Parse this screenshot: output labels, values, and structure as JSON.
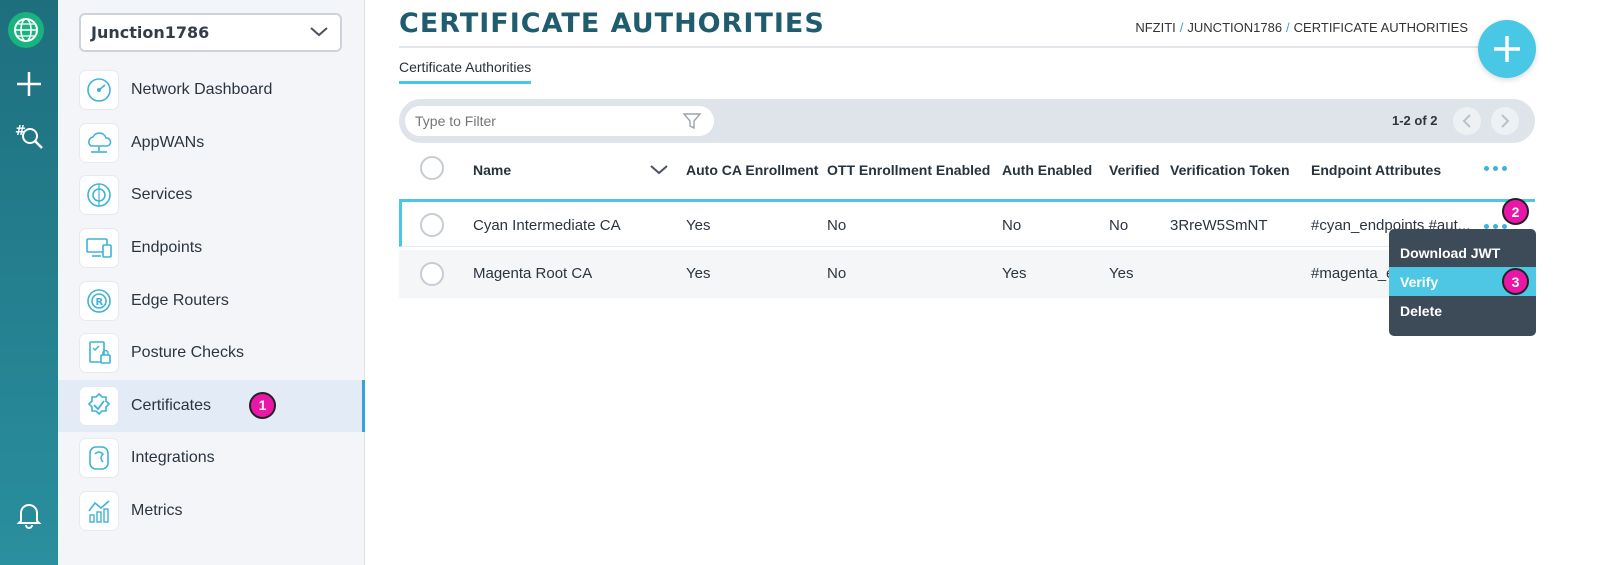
{
  "network_selector": {
    "value": "Junction1786"
  },
  "sidebar": {
    "items": [
      {
        "label": "Network Dashboard",
        "icon": "gauge-icon"
      },
      {
        "label": "AppWANs",
        "icon": "cloud-network-icon"
      },
      {
        "label": "Services",
        "icon": "services-icon"
      },
      {
        "label": "Endpoints",
        "icon": "devices-icon"
      },
      {
        "label": "Edge Routers",
        "icon": "router-icon"
      },
      {
        "label": "Posture Checks",
        "icon": "checklist-lock-icon"
      },
      {
        "label": "Certificates",
        "icon": "certificate-badge-icon"
      },
      {
        "label": "Integrations",
        "icon": "integrations-icon"
      },
      {
        "label": "Metrics",
        "icon": "metrics-icon"
      }
    ],
    "active_index": 6
  },
  "header": {
    "title": "CERTIFICATE AUTHORITIES",
    "breadcrumb": [
      "NFZITI",
      "JUNCTION1786",
      "CERTIFICATE AUTHORITIES"
    ],
    "breadcrumb_sep": "/"
  },
  "tabs": [
    {
      "label": "Certificate Authorities"
    }
  ],
  "toolbar": {
    "filter_placeholder": "Type to Filter",
    "count": "1-2 of 2"
  },
  "table": {
    "columns": [
      "Name",
      "Auto CA Enrollment",
      "OTT Enrollment Enabled",
      "Auth Enabled",
      "Verified",
      "Verification Token",
      "Endpoint Attributes"
    ],
    "rows": [
      {
        "name": "Cyan Intermediate CA",
        "auto_ca": "Yes",
        "ott": "No",
        "auth": "No",
        "verified": "No",
        "token": "3RreW5SmNT",
        "attrs": "#cyan_endpoints #aut..."
      },
      {
        "name": "Magenta Root CA",
        "auto_ca": "Yes",
        "ott": "No",
        "auth": "Yes",
        "verified": "Yes",
        "token": "",
        "attrs": "#magenta_e"
      }
    ]
  },
  "row_menu": {
    "items": [
      "Download JWT",
      "Verify",
      "Delete"
    ],
    "highlighted": "Verify"
  },
  "step_badges": [
    "1",
    "2",
    "3"
  ],
  "colors": {
    "accent": "#49c8e6",
    "title": "#1f5c6d",
    "badge": "#ea16a8",
    "menu_bg": "#3d4a57"
  }
}
